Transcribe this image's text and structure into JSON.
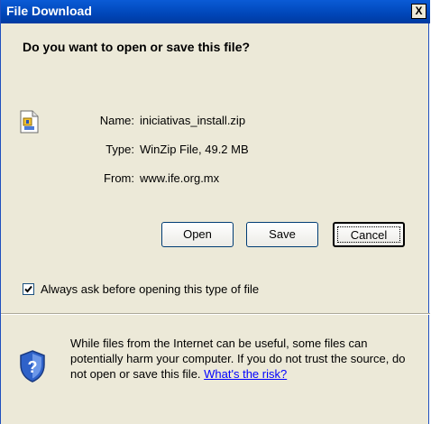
{
  "window": {
    "title": "File Download",
    "close_label": "X"
  },
  "dialog": {
    "question": "Do you want to open or save this file?",
    "file": {
      "name_label": "Name:",
      "name_value": "iniciativas_install.zip",
      "type_label": "Type:",
      "type_value": "WinZip File, 49.2 MB",
      "from_label": "From:",
      "from_value": "www.ife.org.mx",
      "icon": "zip-file-icon"
    },
    "buttons": {
      "open": "Open",
      "save": "Save",
      "cancel": "Cancel"
    },
    "checkbox": {
      "label": "Always ask before opening this type of file",
      "checked": true
    },
    "warning": {
      "icon": "shield-question-icon",
      "text": "While files from the Internet can be useful, some files can potentially harm your computer. If you do not trust the source, do not open or save this file.",
      "link": "What's the risk?"
    }
  },
  "colors": {
    "titlebar": "#0046b8",
    "background": "#ece9d8",
    "link": "#0000ff"
  }
}
